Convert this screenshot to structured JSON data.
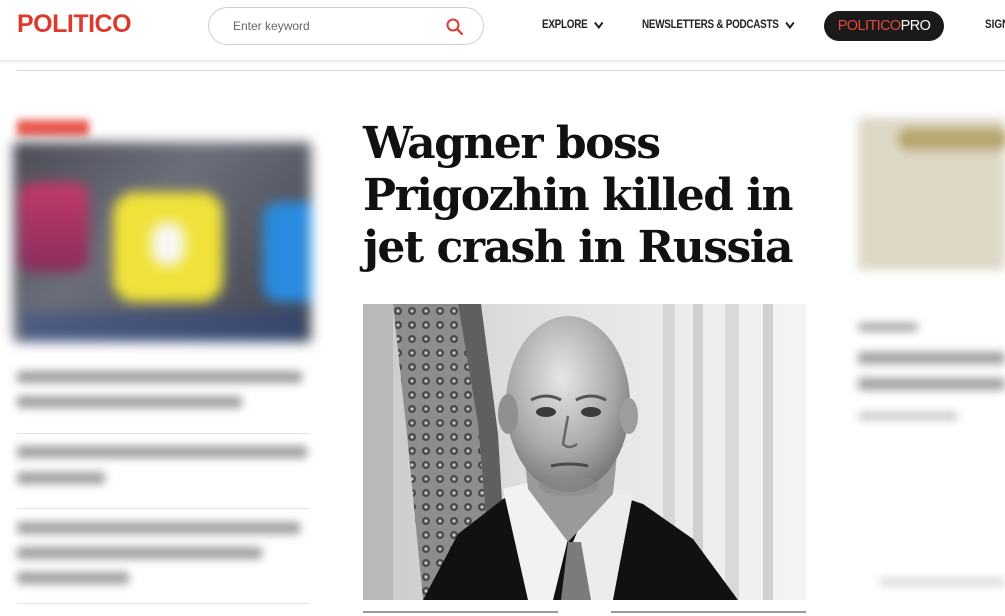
{
  "header": {
    "logo": "POLITICO",
    "search": {
      "placeholder": "Enter keyword"
    },
    "nav": [
      {
        "label": "EXPLORE"
      },
      {
        "label": "NEWSLETTERS & PODCASTS"
      }
    ],
    "pro": {
      "part1": "POLITICO",
      "part2": "PRO"
    },
    "signin_label": "SIGN"
  },
  "main": {
    "headline": "Wagner boss Prigozhin killed in jet crash in Russia"
  },
  "colors": {
    "brand_red": "#dc3a2f",
    "pro_background": "#1a1a1a",
    "text": "#111111"
  }
}
